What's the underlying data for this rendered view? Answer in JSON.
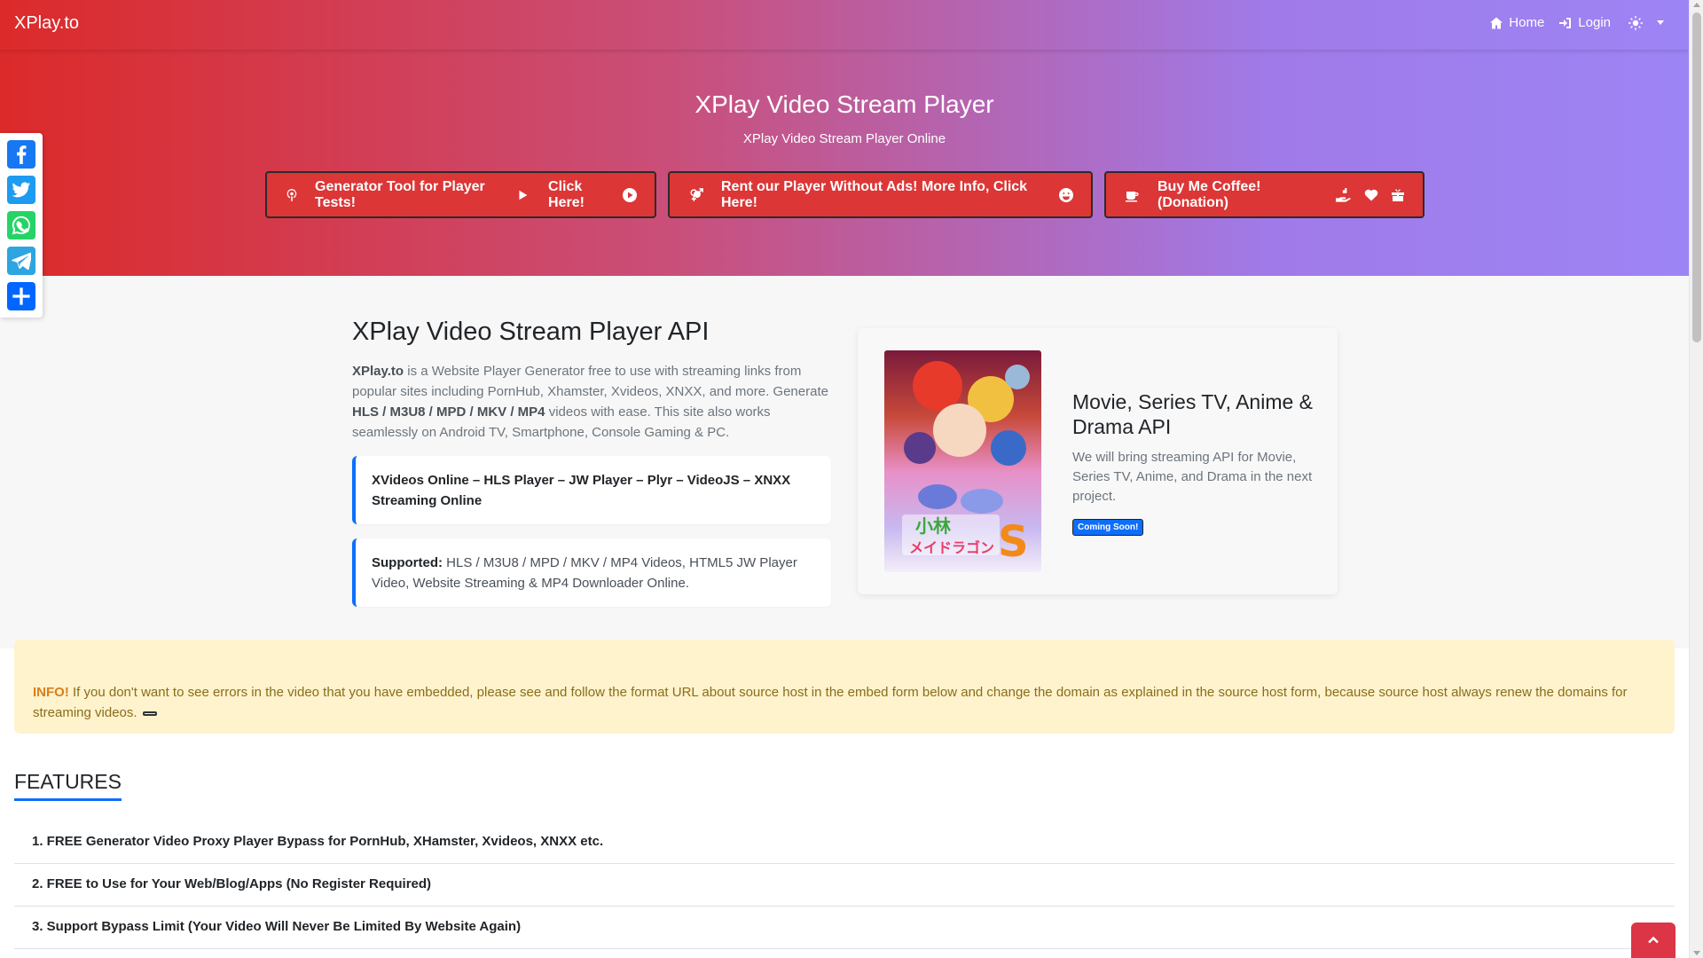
{
  "nav": {
    "brand": "XPlay.to",
    "home_label": "Home",
    "login_label": "Login"
  },
  "hero": {
    "title": "XPlay Video Stream Player",
    "subtitle": "XPlay Video Stream Player Online",
    "buttons": [
      {
        "label": "Generator Tool for Player Tests!",
        "suffix": "Click Here!"
      },
      {
        "label": "Rent our Player Without Ads! More Info, Click Here!"
      },
      {
        "label": "Buy Me Coffee! (Donation)"
      }
    ]
  },
  "social": [
    "facebook",
    "twitter",
    "whatsapp",
    "telegram",
    "share"
  ],
  "api": {
    "title": "XPlay Video Stream Player API",
    "desc_brand": "XPlay.to",
    "desc_part1": " is a Website Player Generator free to use with streaming links from popular sites including PornHub, Xhamster, Xvideos, XNXX, and more. Generate ",
    "desc_formats": "HLS / M3U8 / MPD / MKV / MP4",
    "desc_part2": " videos with ease. This site also works seamlessly on Android TV, Smartphone, Console Gaming & PC.",
    "quote1": "XVideos Online – HLS Player – JW Player – Plyr – VideoJS – XNXX Streaming Online",
    "quote2_label": "Supported:",
    "quote2_text": " HLS / M3U8 / MPD / MKV / MP4 Videos, HTML5 JW Player Video, Website Streaming & MP4 Downloader Online."
  },
  "card": {
    "title": "Movie, Series TV, Anime & Drama API",
    "desc": "We will bring streaming API for Movie, Series TV, Anime, and Drama in the next project.",
    "badge": "Coming Soon!"
  },
  "alert": {
    "label": "INFO!",
    "text": " If you don't want to see errors in the video that you have embedded, please see and follow the format URL about source host in the embed form below and change the domain as explained in the source host form, because source host always renew the domains for streaming videos."
  },
  "features": {
    "title": "FEATURES",
    "items": [
      "1. FREE Generator Video Proxy Player Bypass for PornHub, XHamster, Xvideos, XNXX etc.",
      "2. FREE to Use for Your Web/Blog/Apps (No Register Required)",
      "3. Support Bypass Limit (Your Video Will Never Be Limited By Website Again)"
    ]
  },
  "colors": {
    "button_red": "#dc3636",
    "accent_blue": "#0d6efd",
    "alert_bg": "#fff3cd"
  }
}
